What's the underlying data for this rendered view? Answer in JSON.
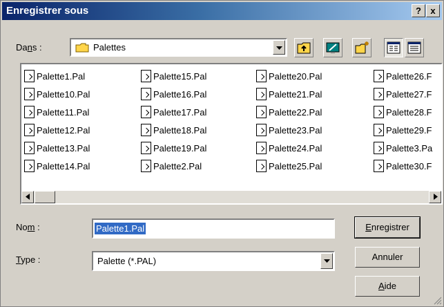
{
  "window": {
    "title": "Enregistrer sous",
    "help_label": "?",
    "close_label": "x"
  },
  "location": {
    "label_prefix": "Da",
    "label_underlined": "n",
    "label_suffix": "s :",
    "value": "Palettes"
  },
  "files": {
    "columns": [
      [
        "Palette1.Pal",
        "Palette10.Pal",
        "Palette11.Pal",
        "Palette12.Pal",
        "Palette13.Pal",
        "Palette14.Pal"
      ],
      [
        "Palette15.Pal",
        "Palette16.Pal",
        "Palette17.Pal",
        "Palette18.Pal",
        "Palette19.Pal",
        "Palette2.Pal"
      ],
      [
        "Palette20.Pal",
        "Palette21.Pal",
        "Palette22.Pal",
        "Palette23.Pal",
        "Palette24.Pal",
        "Palette25.Pal"
      ],
      [
        "Palette26.F",
        "Palette27.F",
        "Palette28.F",
        "Palette29.F",
        "Palette3.Pa",
        "Palette30.F"
      ]
    ]
  },
  "form": {
    "name_label_prefix": "No",
    "name_label_underlined": "m",
    "name_label_suffix": " :",
    "name_value": "Palette1.Pal",
    "type_label_underlined": "T",
    "type_label_suffix": "ype :",
    "type_value": "Palette (*.PAL)"
  },
  "buttons": {
    "save_underlined": "E",
    "save_rest": "nregistrer",
    "cancel": "Annuler",
    "help_underlined": "A",
    "help_rest": "ide"
  },
  "colors": {
    "title_start": "#0a246a",
    "title_end": "#a6caf0",
    "selection": "#316ac5",
    "face": "#d4d0c8"
  }
}
